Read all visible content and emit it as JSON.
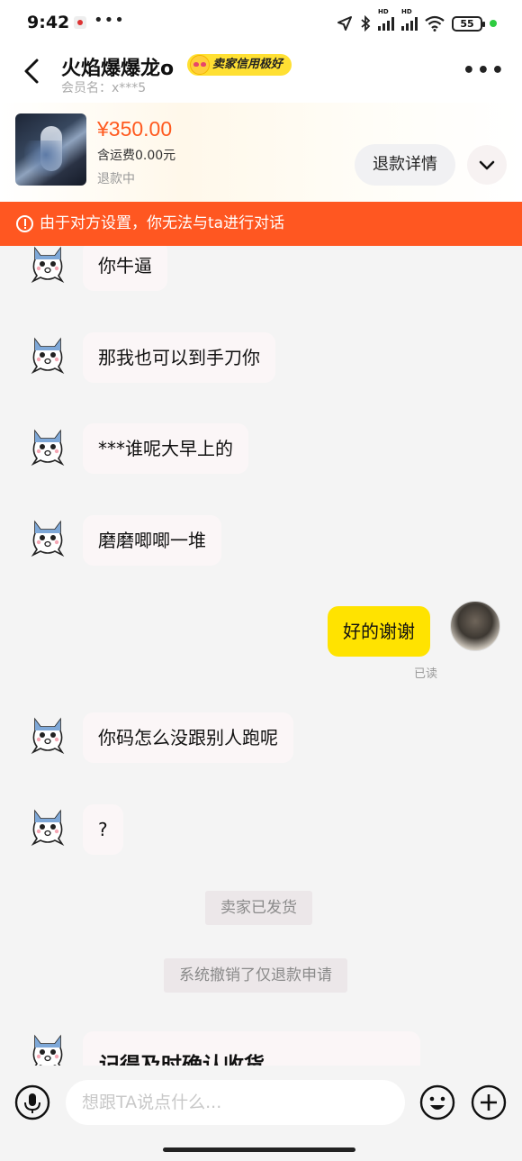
{
  "status_bar": {
    "time": "9:42",
    "more": "•••",
    "battery": "55"
  },
  "header": {
    "shop_name": "火焰爆爆龙o",
    "credit_badge": "卖家信用极好",
    "member_label": "会员名：x***5"
  },
  "order": {
    "price": "¥350.00",
    "shipping": "含运费0.00元",
    "status": "退款中",
    "refund_detail_button": "退款详情"
  },
  "warning_banner": "由于对方设置，你无法与ta进行对话",
  "messages": {
    "m1": "你牛逼",
    "m2": "那我也可以到手刀你",
    "m3": "***谁呢大早上的",
    "m4": "磨磨唧唧一堆",
    "me1": "好的谢谢",
    "me1_status": "已读",
    "m5": "你码怎么没跟别人跑呢",
    "m6": "?",
    "m7": "记得及时确认收货"
  },
  "system_notices": {
    "n1": "卖家已发货",
    "n2": "系统撤销了仅退款申请"
  },
  "input_bar": {
    "placeholder": "想跟TA说点什么..."
  },
  "colors": {
    "accent_orange": "#ff5721",
    "price_orange": "#ff5a1f",
    "my_bubble": "#ffe300",
    "credit_badge": "#ffe033"
  },
  "icons": [
    "back-icon",
    "more-icon",
    "chevron-down-icon",
    "alert-circle-icon",
    "mic-icon",
    "emoji-icon",
    "plus-icon",
    "ghost-cat-avatar"
  ]
}
